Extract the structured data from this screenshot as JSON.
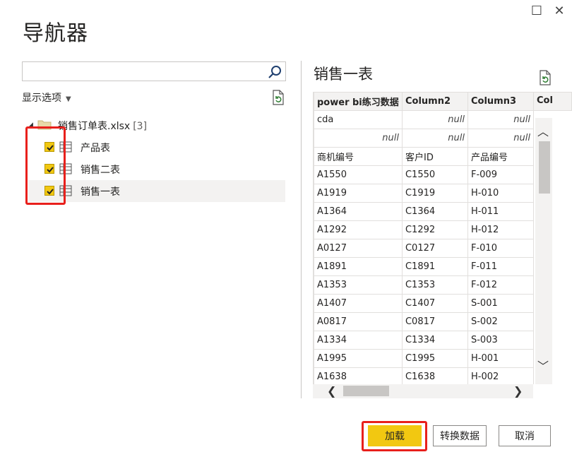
{
  "dialog": {
    "title": "导航器"
  },
  "search": {
    "value": "",
    "placeholder": ""
  },
  "display_options": {
    "label": "显示选项"
  },
  "tree": {
    "file": {
      "name": "销售订单表.xlsx",
      "count": "[3]"
    },
    "items": [
      {
        "label": "产品表",
        "checked": true
      },
      {
        "label": "销售二表",
        "checked": true
      },
      {
        "label": "销售一表",
        "checked": true,
        "selected": true
      }
    ]
  },
  "preview": {
    "title": "销售一表",
    "columns": [
      "power bi练习数据",
      "Column2",
      "Column3",
      "Col"
    ],
    "rows": [
      [
        "cda",
        "null",
        "null"
      ],
      [
        "null",
        "null",
        "null"
      ],
      [
        "商机编号",
        "客户ID",
        "产品编号"
      ],
      [
        "A1550",
        "C1550",
        "F-009"
      ],
      [
        "A1919",
        "C1919",
        "H-010"
      ],
      [
        "A1364",
        "C1364",
        "H-011"
      ],
      [
        "A1292",
        "C1292",
        "H-012"
      ],
      [
        "A0127",
        "C0127",
        "F-010"
      ],
      [
        "A1891",
        "C1891",
        "F-011"
      ],
      [
        "A1353",
        "C1353",
        "F-012"
      ],
      [
        "A1407",
        "C1407",
        "S-001"
      ],
      [
        "A0817",
        "C0817",
        "S-002"
      ],
      [
        "A1334",
        "C1334",
        "S-003"
      ],
      [
        "A1995",
        "C1995",
        "H-001"
      ],
      [
        "A1638",
        "C1638",
        "H-002"
      ]
    ]
  },
  "buttons": {
    "load": "加载",
    "transform": "转换数据",
    "cancel": "取消"
  },
  "colors": {
    "accent": "#f2c811",
    "highlight": "#e8201c"
  }
}
